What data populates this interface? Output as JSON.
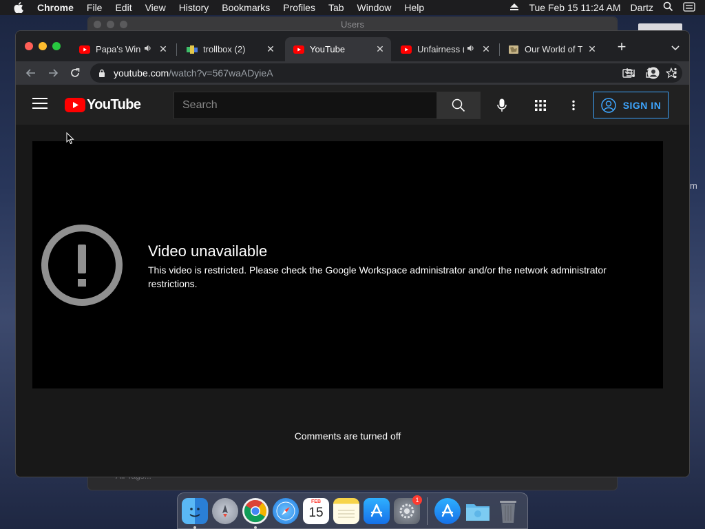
{
  "menubar": {
    "app_name": "Chrome",
    "menus": [
      "File",
      "Edit",
      "View",
      "History",
      "Bookmarks",
      "Profiles",
      "Tab",
      "Window",
      "Help"
    ],
    "clock": "Tue Feb 15  11:24 AM",
    "user": "Dartz"
  },
  "finder": {
    "title": "Users",
    "sidebar_item": "All Tags..."
  },
  "desktop_edge_text": "m",
  "chrome": {
    "tabs": [
      {
        "title": "Papa's Wing",
        "favicon": "youtube-icon",
        "audio": true,
        "active": false
      },
      {
        "title": "trollbox (2)",
        "favicon": "trollbox-icon",
        "audio": false,
        "active": false
      },
      {
        "title": "YouTube",
        "favicon": "youtube-icon",
        "audio": false,
        "active": true
      },
      {
        "title": "Unfairness (",
        "favicon": "youtube-icon",
        "audio": true,
        "active": false
      },
      {
        "title": "Our World of Te",
        "favicon": "map-icon",
        "audio": false,
        "active": false
      }
    ],
    "url_host": "youtube.com",
    "url_path": "/watch?v=567waADyieA"
  },
  "youtube": {
    "logo_text": "YouTube",
    "search_placeholder": "Search",
    "sign_in": "SIGN IN",
    "error_title": "Video unavailable",
    "error_message": "This video is restricted. Please check the Google Workspace administrator and/or the network administrator restrictions.",
    "comments_status": "Comments are turned off"
  },
  "dock": {
    "apps": [
      "finder-icon",
      "launchpad-icon",
      "chrome-icon",
      "safari-icon",
      "calendar-icon",
      "notes-icon",
      "app-store-icon",
      "system-preferences-icon",
      "app-store-icon",
      "downloads-folder-icon",
      "trash-icon"
    ],
    "calendar_month": "FEB",
    "calendar_day": "15",
    "system_preferences_badge": "1"
  },
  "colors": {
    "youtube_red": "#ff0000",
    "signin_blue": "#3ea6ff",
    "page_bg": "#181818",
    "header_bg": "#212121"
  }
}
